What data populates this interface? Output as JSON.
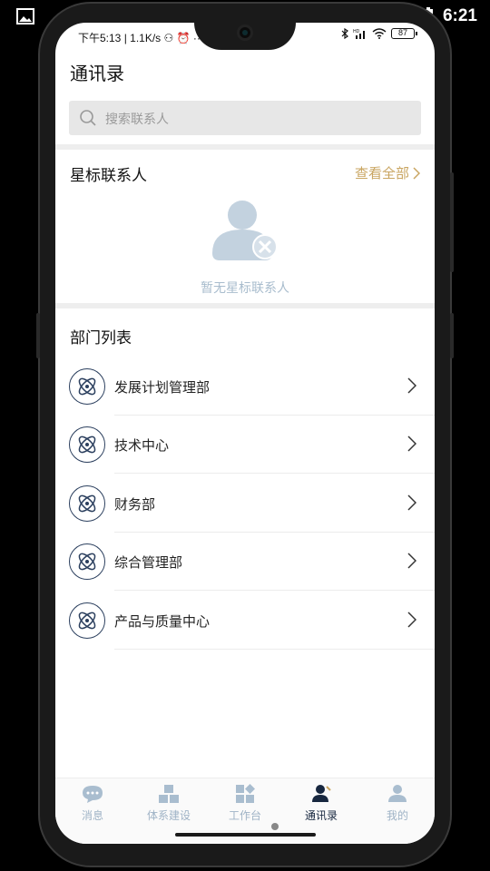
{
  "system_status": {
    "time": "6:21"
  },
  "phone_status": {
    "left_text": "下午5:13 | 1.1K/s ⚇ ⏰ ··",
    "battery": "87"
  },
  "page": {
    "title": "通讯录"
  },
  "search": {
    "placeholder": "搜索联系人"
  },
  "starred": {
    "title": "星标联系人",
    "view_all": "查看全部",
    "empty_text": "暂无星标联系人"
  },
  "departments": {
    "title": "部门列表",
    "items": [
      {
        "label": "发展计划管理部"
      },
      {
        "label": "技术中心"
      },
      {
        "label": "财务部"
      },
      {
        "label": "综合管理部"
      },
      {
        "label": "产品与质量中心"
      }
    ]
  },
  "tabs": [
    {
      "label": "消息",
      "icon": "chat-bubble-icon"
    },
    {
      "label": "体系建设",
      "icon": "boxes-icon"
    },
    {
      "label": "工作台",
      "icon": "grid-icon"
    },
    {
      "label": "通讯录",
      "icon": "contacts-icon",
      "active": true
    },
    {
      "label": "我的",
      "icon": "profile-icon"
    }
  ],
  "colors": {
    "accent": "#c9a561",
    "active_tab": "#17273f",
    "inactive_tab": "#9fb3c6",
    "dept_icon": "#2b3f5e"
  }
}
